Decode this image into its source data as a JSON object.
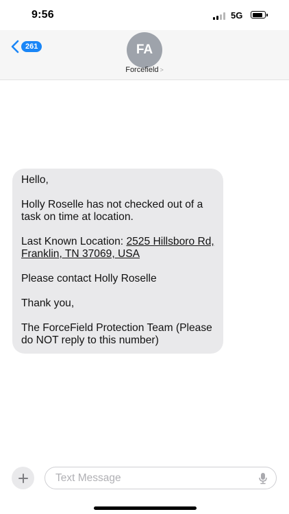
{
  "status_bar": {
    "time": "9:56",
    "network": "5G",
    "signal_bars_filled": 2,
    "signal_bars_total": 4
  },
  "header": {
    "back_badge": "261",
    "avatar_initials": "FA",
    "contact_name": "Forcefield",
    "contact_chevron": ">"
  },
  "message": {
    "greeting": "Hello,",
    "body": "Holly Roselle has not checked out of a task on time at location.",
    "location_label": "Last Known Location:",
    "location_address": "2525 Hillsboro Rd, Franklin, TN 37069, USA",
    "contact_line": "Please contact Holly Roselle",
    "thanks": "Thank you,",
    "signature": "The ForceField Protection Team (Please do NOT reply to this number)"
  },
  "composer": {
    "placeholder": "Text Message",
    "plus_symbol": "+"
  },
  "colors": {
    "accent": "#1a86f7",
    "bubble": "#e9e9eb",
    "avatar": "#9ea3ab"
  },
  "icons": {
    "back": "chevron-left-icon",
    "plus": "plus-icon",
    "mic": "microphone-icon"
  }
}
